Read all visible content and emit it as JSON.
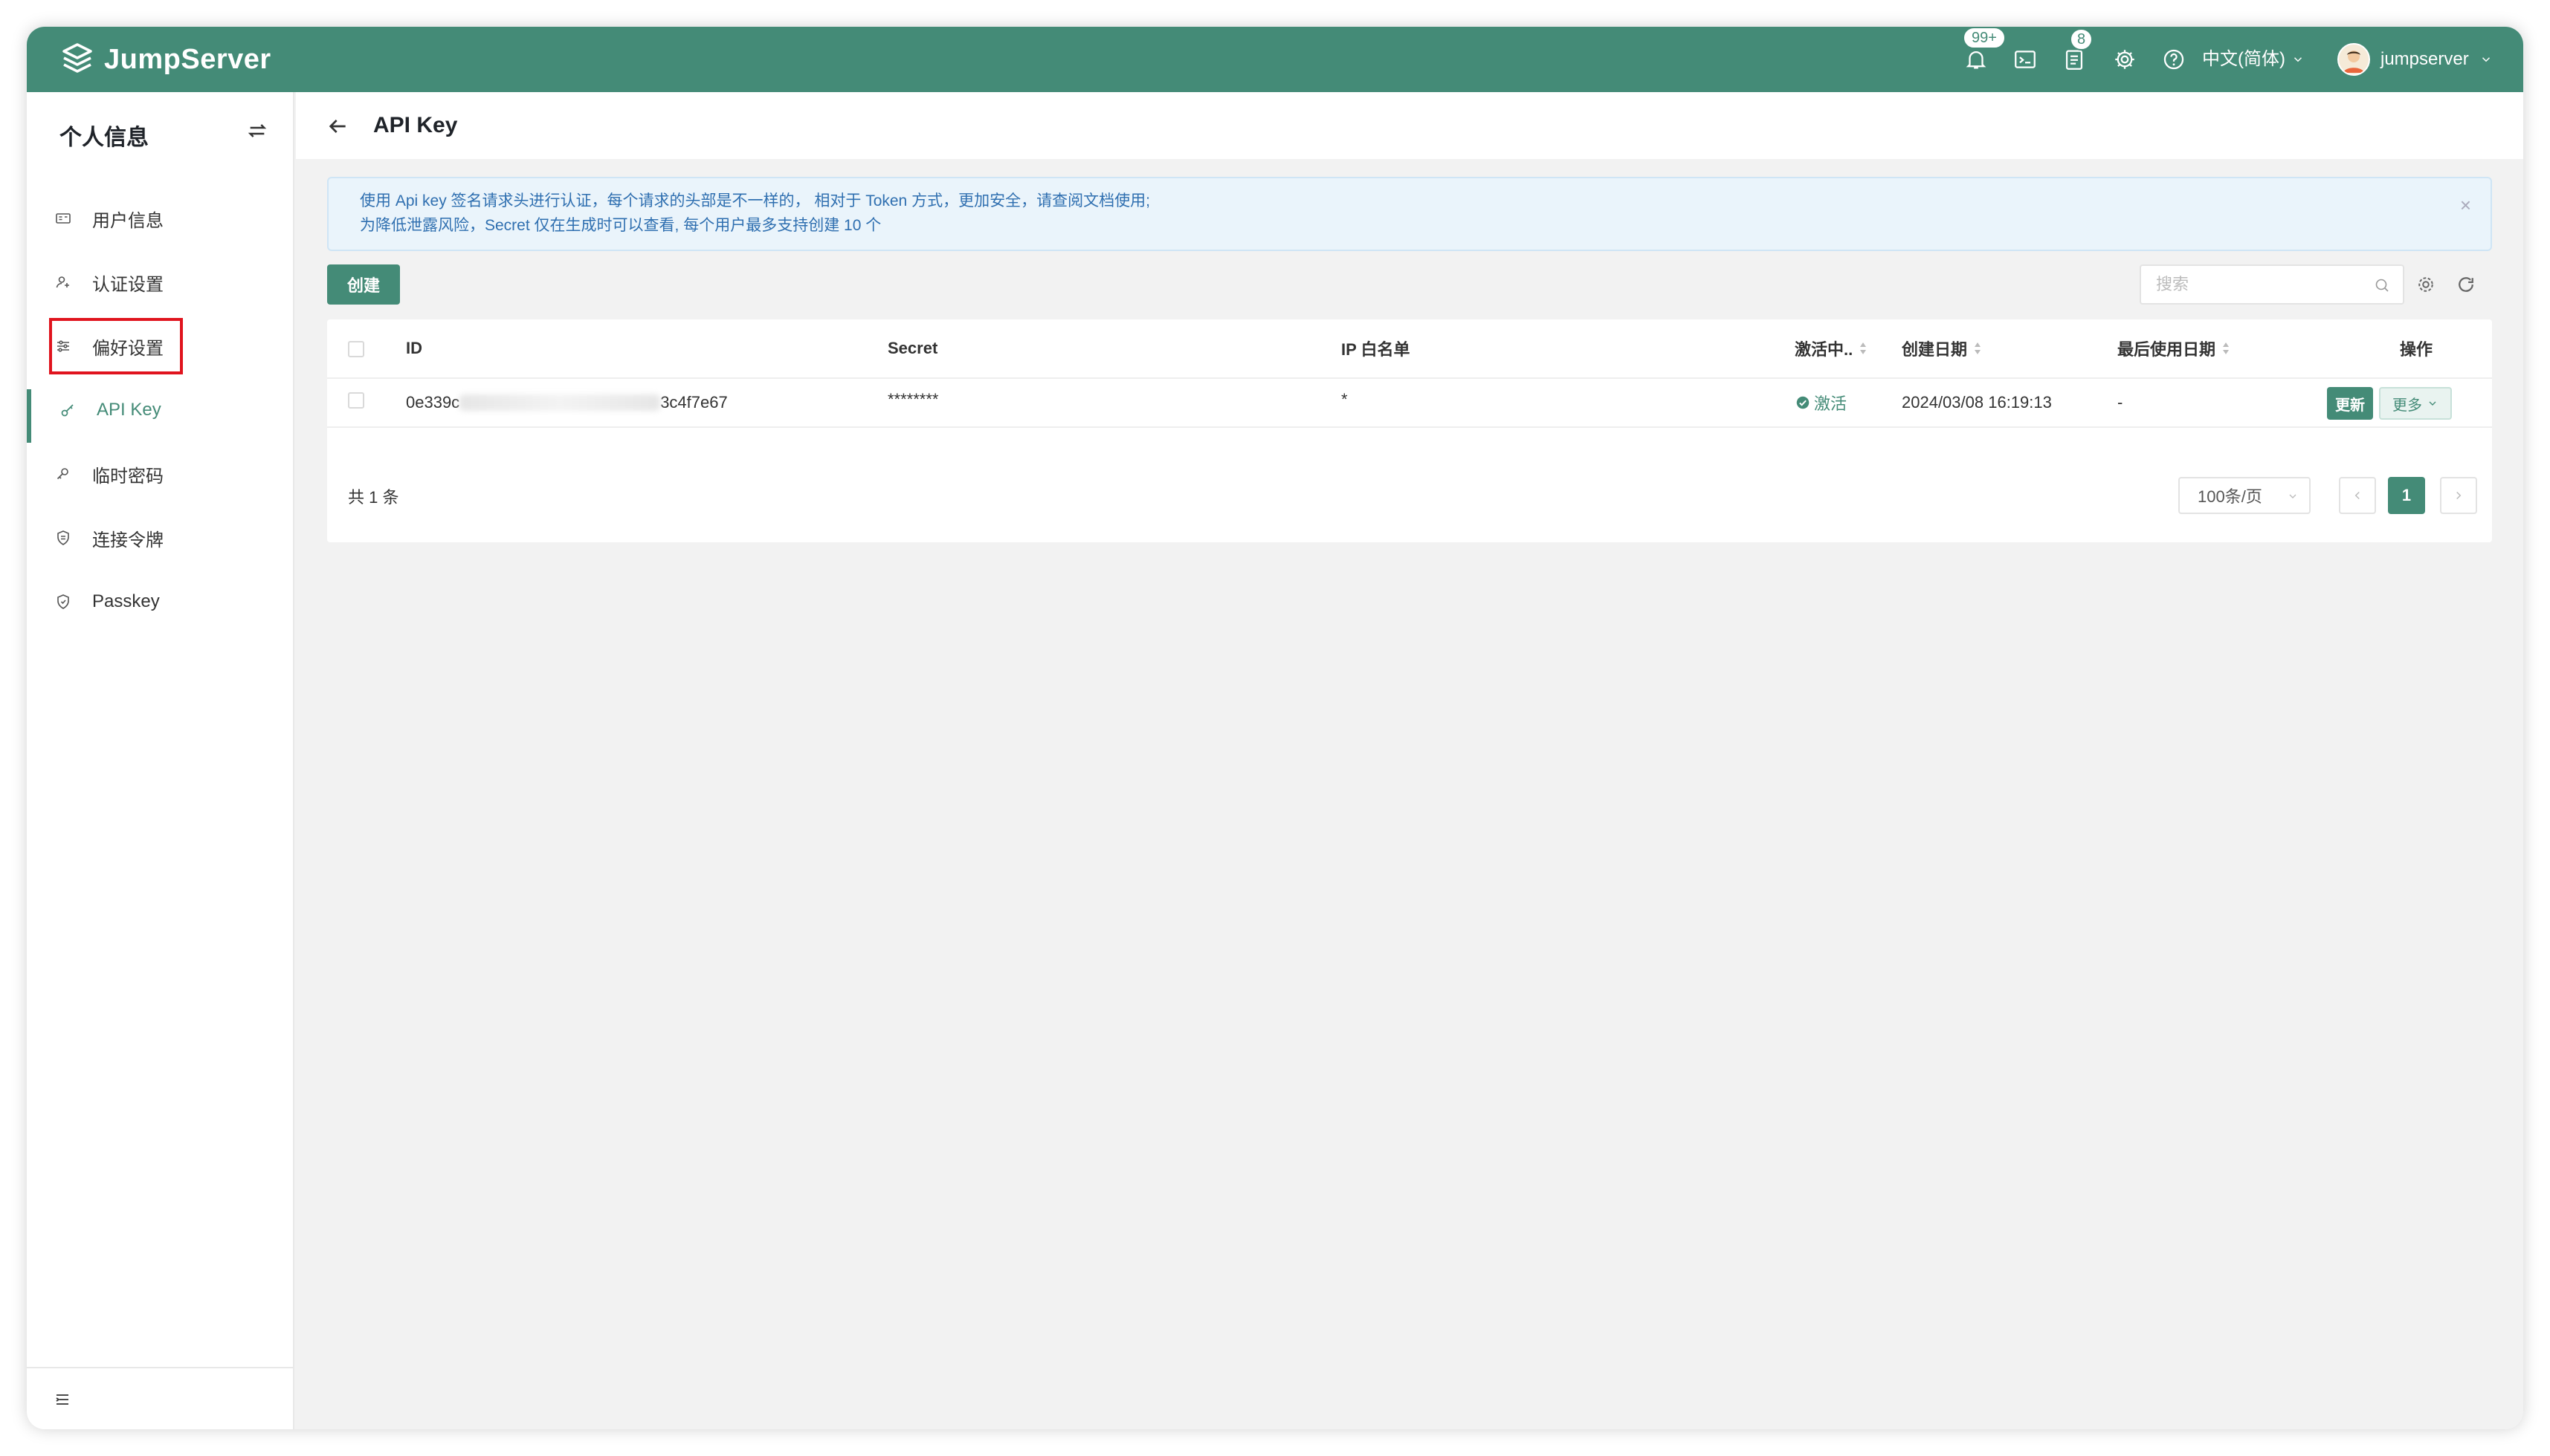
{
  "header": {
    "logo_text": "JumpServer",
    "notifications_badge": "99+",
    "tasks_badge": "8",
    "language": "中文(简体)",
    "username": "jumpserver"
  },
  "sidebar": {
    "title": "个人信息",
    "items": [
      {
        "label": "用户信息",
        "icon": "id-card-icon"
      },
      {
        "label": "认证设置",
        "icon": "user-auth-icon"
      },
      {
        "label": "偏好设置",
        "icon": "sliders-icon"
      },
      {
        "label": "API Key",
        "icon": "key-icon",
        "active": true
      },
      {
        "label": "临时密码",
        "icon": "temp-key-icon"
      },
      {
        "label": "连接令牌",
        "icon": "token-icon"
      },
      {
        "label": "Passkey",
        "icon": "shield-icon"
      }
    ]
  },
  "page": {
    "title": "API Key",
    "alert_line1": "使用 Api key 签名请求头进行认证，每个请求的头部是不一样的， 相对于 Token 方式，更加安全，请查阅文档使用;",
    "alert_line2": "为降低泄露风险，Secret 仅在生成时可以查看, 每个用户最多支持创建 10 个",
    "alert_close": "×",
    "create_label": "创建",
    "search_placeholder": "搜索"
  },
  "table": {
    "columns": [
      "ID",
      "Secret",
      "IP 白名单",
      "激活中..",
      "创建日期",
      "最后使用日期",
      "操作"
    ],
    "rows": [
      {
        "id_start": "0e339c",
        "id_end": "3c4f7e67",
        "secret": "********",
        "ip_whitelist": "*",
        "status": "激活",
        "created": "2024/03/08 16:19:13",
        "last_used": "-",
        "update_label": "更新",
        "more_label": "更多"
      }
    ],
    "total_text": "共 1 条",
    "page_size": "100条/页",
    "current_page": "1"
  },
  "colors": {
    "brand": "#448b77",
    "alert_text": "#2f6fb0",
    "highlight": "#e0141e"
  }
}
